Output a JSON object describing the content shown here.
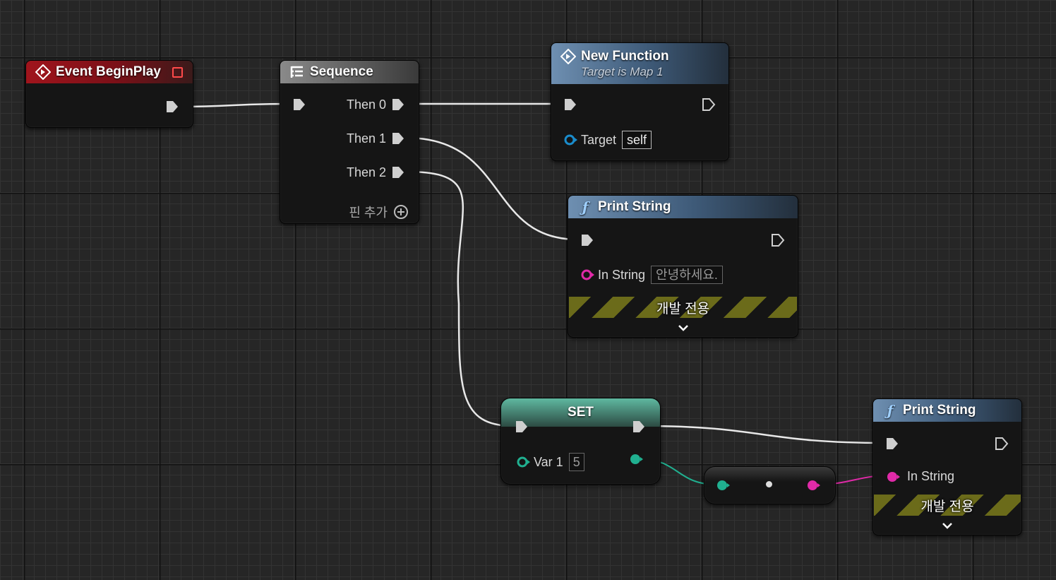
{
  "nodes": {
    "event_begin_play": {
      "title": "Event BeginPlay"
    },
    "sequence": {
      "title": "Sequence",
      "outputs": [
        "Then 0",
        "Then 1",
        "Then 2"
      ],
      "add_pin_label": "핀 추가"
    },
    "new_function": {
      "title": "New Function",
      "subtitle": "Target is Map 1",
      "target_label": "Target",
      "target_value": "self"
    },
    "print_string_1": {
      "title": "Print String",
      "in_string_label": "In String",
      "in_string_value": "안녕하세요.",
      "dev_only_label": "개발 전용"
    },
    "set": {
      "title": "SET",
      "var_label": "Var 1",
      "var_value": "5"
    },
    "print_string_2": {
      "title": "Print String",
      "in_string_label": "In String",
      "dev_only_label": "개발 전용"
    }
  },
  "colors": {
    "exec_pin": "#cfcfcf",
    "object_pin": "#1a8ccc",
    "string_pin": "#e02aa8",
    "int_pin": "#20b090",
    "event_header": "#a0141c",
    "function_header": "#6e8fb1",
    "set_header": "#5fb8a0"
  },
  "icons": {
    "event": "diamond-arrow-icon",
    "sequence": "sequence-icon",
    "function": "function-f-icon",
    "add_pin": "plus-circle-icon",
    "expand": "chevron-down-icon"
  }
}
